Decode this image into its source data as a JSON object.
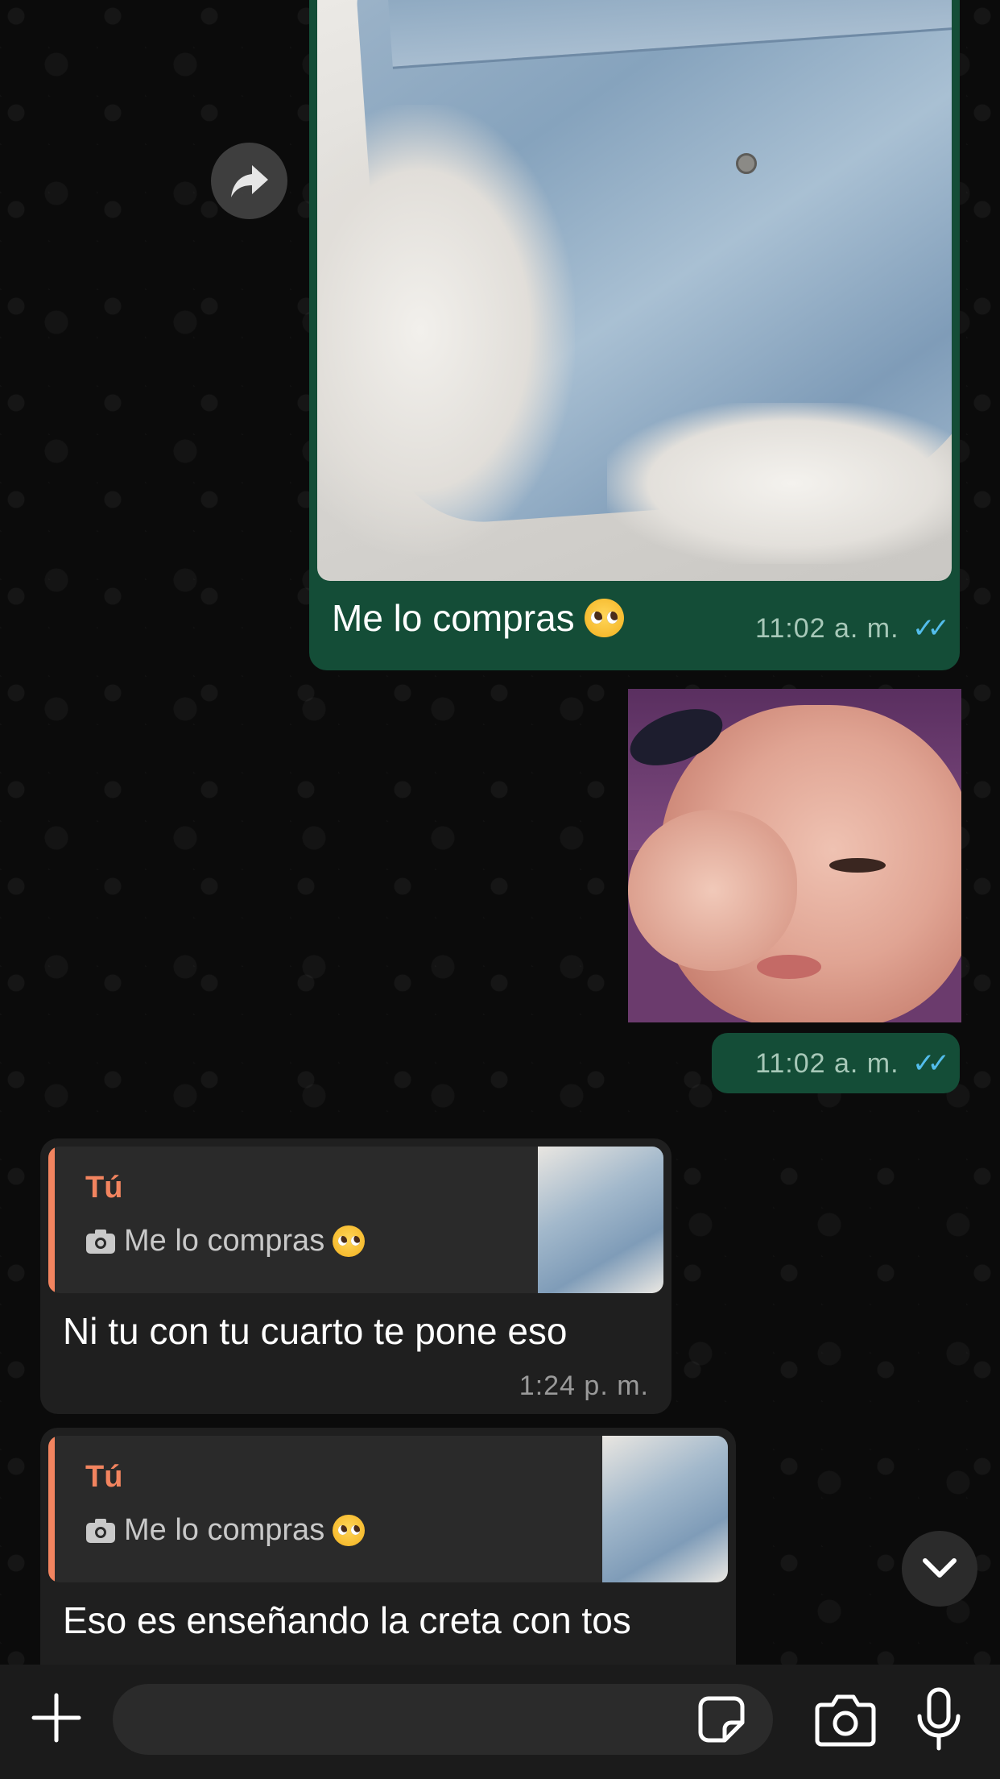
{
  "messages": {
    "jeans_image": {
      "caption": "Me lo compras",
      "time": "11:02 a. m."
    },
    "baby_image": {
      "time": "11:02 a. m."
    },
    "reply_1": {
      "quote_author": "Tú",
      "quote_text": "Me lo compras",
      "text": "Ni tu con tu cuarto te pone eso",
      "time": "1:24 p. m."
    },
    "reply_2": {
      "quote_author": "Tú",
      "quote_text": "Me lo compras",
      "text": "Eso es enseñando la creta con tos"
    }
  },
  "composer": {
    "placeholder": ""
  },
  "icons": {
    "forward": "forward-arrow-icon",
    "scroll_down": "chevron-down-icon",
    "plus": "plus-icon",
    "sticker": "sticker-icon",
    "camera": "camera-icon",
    "mic": "microphone-icon",
    "read_receipt": "double-check-icon",
    "quote_photo": "camera-small-icon"
  },
  "colors": {
    "outgoing_bubble": "#144d37",
    "incoming_bubble": "#1f1f1f",
    "quote_accent": "#f2845f",
    "read_tick": "#53bdeb"
  }
}
